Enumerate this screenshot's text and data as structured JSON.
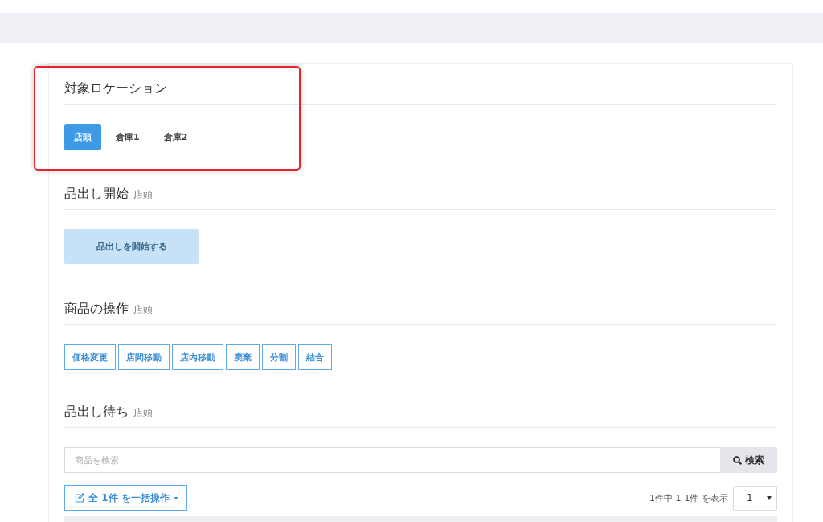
{
  "location": {
    "title": "対象ロケーション",
    "tabs": [
      {
        "label": "店頭",
        "selected": true
      },
      {
        "label": "倉庫1",
        "selected": false
      },
      {
        "label": "倉庫2",
        "selected": false
      }
    ]
  },
  "start": {
    "title": "品出し開始",
    "location": "店頭",
    "button": "品出しを開始する"
  },
  "operations": {
    "title": "商品の操作",
    "location": "店頭",
    "buttons": [
      "価格変更",
      "店間移動",
      "店内移動",
      "廃棄",
      "分割",
      "結合"
    ]
  },
  "waiting": {
    "title": "品出し待ち",
    "location": "店頭",
    "search": {
      "placeholder": "商品を検索",
      "button": "検索"
    },
    "bulk_button": "全 1件 を一括操作",
    "summary": "1件中 1-1件 を表示",
    "page_select": "1"
  }
}
